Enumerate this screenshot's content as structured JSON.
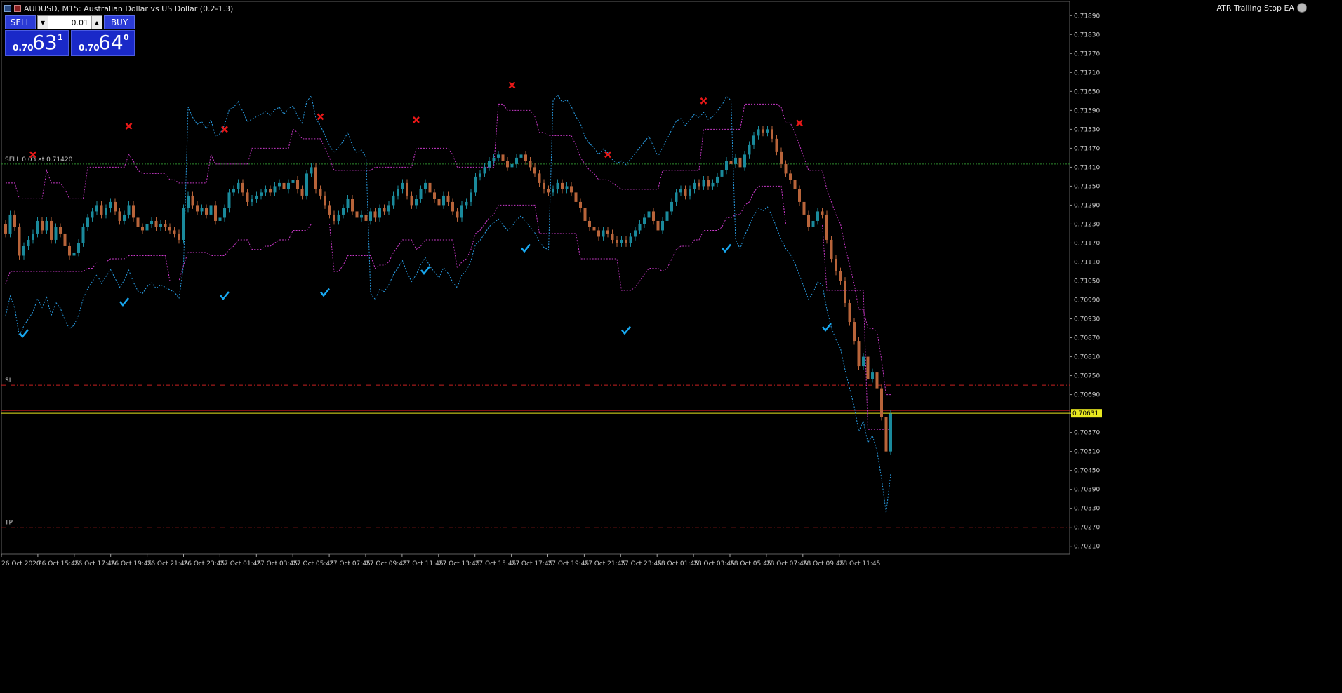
{
  "window": {
    "title": "AUDUSD, M15:  Australian Dollar vs US Dollar (0.2-1.3)",
    "ea_name": "ATR Trailing Stop EA"
  },
  "trade_panel": {
    "sell_label": "SELL",
    "buy_label": "BUY",
    "lot_value": "0.01",
    "sell_price_prefix": "0.70",
    "sell_price_big": "63",
    "sell_price_sup": "1",
    "buy_price_prefix": "0.70",
    "buy_price_big": "64",
    "buy_price_sup": "0"
  },
  "lines": {
    "order_label": "SELL 0.03 at 0.71420",
    "sl_label": "SL",
    "tp_label": "TP",
    "current_price_label": "0.70631"
  },
  "colors": {
    "background": "#000000",
    "bull_candle": "#1a8a9c",
    "bear_candle": "#b8643a",
    "trailing_stop": "#2aa0e8",
    "bands": "#c838c8",
    "order_line": "#2e8b2e",
    "sl_tp_line": "#c82020",
    "price_line_bid": "#e8e820",
    "price_line_ask": "#d02020",
    "buy_signal": "#18a8f0",
    "sell_signal": "#e81818"
  },
  "chart_data": {
    "type": "candlestick",
    "symbol": "AUDUSD",
    "timeframe": "M15",
    "y_ticks": [
      "0.71890",
      "0.71830",
      "0.71770",
      "0.71710",
      "0.71650",
      "0.71590",
      "0.71530",
      "0.71470",
      "0.71410",
      "0.71350",
      "0.71290",
      "0.71230",
      "0.71170",
      "0.71110",
      "0.71050",
      "0.70990",
      "0.70930",
      "0.70870",
      "0.70810",
      "0.70750",
      "0.70690",
      "0.70631",
      "0.70570",
      "0.70510",
      "0.70450",
      "0.70390",
      "0.70330",
      "0.70270",
      "0.70210"
    ],
    "x_ticks": [
      "26 Oct 2020",
      "26 Oct 15:45",
      "26 Oct 17:45",
      "26 Oct 19:45",
      "26 Oct 21:45",
      "26 Oct 23:45",
      "27 Oct 01:45",
      "27 Oct 03:45",
      "27 Oct 05:45",
      "27 Oct 07:45",
      "27 Oct 09:45",
      "27 Oct 11:45",
      "27 Oct 13:45",
      "27 Oct 15:45",
      "27 Oct 17:45",
      "27 Oct 19:45",
      "27 Oct 21:45",
      "27 Oct 23:45",
      "28 Oct 01:45",
      "28 Oct 03:45",
      "28 Oct 05:45",
      "28 Oct 07:45",
      "28 Oct 09:45",
      "28 Oct 11:45"
    ],
    "ylim": [
      0.70185,
      0.71935
    ],
    "order_price": 0.7142,
    "sl_price": 0.7072,
    "tp_price": 0.7027,
    "bid": 0.70631,
    "ask": 0.7064,
    "closes": [
      0.712,
      0.7126,
      0.7122,
      0.7113,
      0.7116,
      0.7118,
      0.712,
      0.7124,
      0.7121,
      0.7124,
      0.7118,
      0.7122,
      0.712,
      0.7116,
      0.7113,
      0.7114,
      0.7117,
      0.7122,
      0.7125,
      0.7127,
      0.7129,
      0.7126,
      0.7128,
      0.713,
      0.7127,
      0.7124,
      0.7126,
      0.7129,
      0.7125,
      0.7122,
      0.7121,
      0.7123,
      0.7124,
      0.7122,
      0.7123,
      0.7122,
      0.7121,
      0.712,
      0.7118,
      0.7128,
      0.7132,
      0.7129,
      0.7127,
      0.7128,
      0.7126,
      0.7129,
      0.7124,
      0.7125,
      0.7128,
      0.7133,
      0.7134,
      0.7136,
      0.7133,
      0.713,
      0.7131,
      0.7132,
      0.7133,
      0.7134,
      0.7133,
      0.7135,
      0.7136,
      0.7134,
      0.7136,
      0.7137,
      0.7134,
      0.7132,
      0.7139,
      0.7141,
      0.7134,
      0.7132,
      0.7129,
      0.7126,
      0.7124,
      0.7126,
      0.7128,
      0.7131,
      0.7127,
      0.7125,
      0.7126,
      0.7124,
      0.7127,
      0.7125,
      0.7128,
      0.7127,
      0.7129,
      0.7132,
      0.7134,
      0.7136,
      0.7132,
      0.7129,
      0.7131,
      0.7134,
      0.7136,
      0.7133,
      0.7131,
      0.7129,
      0.7132,
      0.713,
      0.7127,
      0.7125,
      0.7129,
      0.713,
      0.7133,
      0.7138,
      0.7139,
      0.7141,
      0.7143,
      0.7144,
      0.7145,
      0.7143,
      0.7141,
      0.7142,
      0.7144,
      0.7145,
      0.7143,
      0.7141,
      0.7139,
      0.7136,
      0.7134,
      0.7133,
      0.7134,
      0.7136,
      0.7134,
      0.7135,
      0.7133,
      0.713,
      0.7128,
      0.7124,
      0.7122,
      0.7121,
      0.7119,
      0.7121,
      0.712,
      0.7118,
      0.7117,
      0.7118,
      0.7117,
      0.7119,
      0.7121,
      0.7123,
      0.7125,
      0.7127,
      0.7124,
      0.7121,
      0.7124,
      0.7127,
      0.713,
      0.7133,
      0.7134,
      0.7132,
      0.7134,
      0.7136,
      0.7135,
      0.7137,
      0.7135,
      0.7136,
      0.7138,
      0.714,
      0.7143,
      0.7142,
      0.7144,
      0.7141,
      0.7145,
      0.7148,
      0.7151,
      0.7153,
      0.7152,
      0.7153,
      0.715,
      0.7146,
      0.7142,
      0.7139,
      0.7137,
      0.7134,
      0.713,
      0.7126,
      0.7122,
      0.7124,
      0.7127,
      0.7126,
      0.7118,
      0.7112,
      0.7108,
      0.7105,
      0.7098,
      0.7092,
      0.7086,
      0.7078,
      0.7081,
      0.7074,
      0.7076,
      0.7071,
      0.7062,
      0.7051,
      0.7063
    ],
    "trailing_stop_markers": {
      "buy": 9,
      "sell": 9
    }
  }
}
